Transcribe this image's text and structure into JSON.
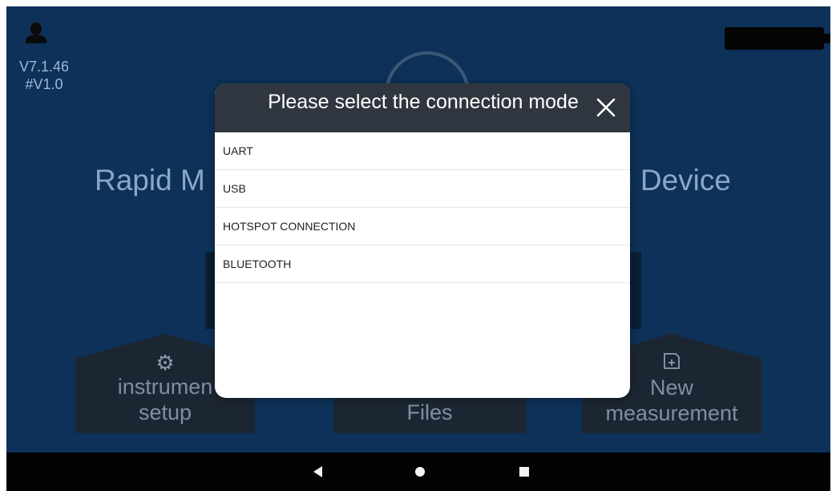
{
  "header": {
    "version": "V7.1.46",
    "sub_version": "#V1.0",
    "user_icon": "user-icon",
    "battery_icon": "battery-icon"
  },
  "background": {
    "title_left": "Rapid M",
    "title_right": "g Device"
  },
  "tiles": [
    {
      "label_line1": "instrumen",
      "label_line2": "setup",
      "icon": "gear-icon"
    },
    {
      "label_line1": "",
      "label_line2": "Files",
      "icon": ""
    },
    {
      "label_line1": "New",
      "label_line2": "measurement",
      "icon": "add-document-icon"
    }
  ],
  "dialog": {
    "title": "Please select the connection mode",
    "close_icon": "close-icon",
    "options": [
      "UART",
      "USB",
      "HOTSPOT CONNECTION",
      "BLUETOOTH"
    ]
  },
  "navbar": {
    "back_icon": "back-icon",
    "home_icon": "home-icon",
    "recents_icon": "recents-icon"
  },
  "colors": {
    "background": "#0d3158",
    "dialog_header": "#30363f",
    "navbar": "#020202"
  }
}
